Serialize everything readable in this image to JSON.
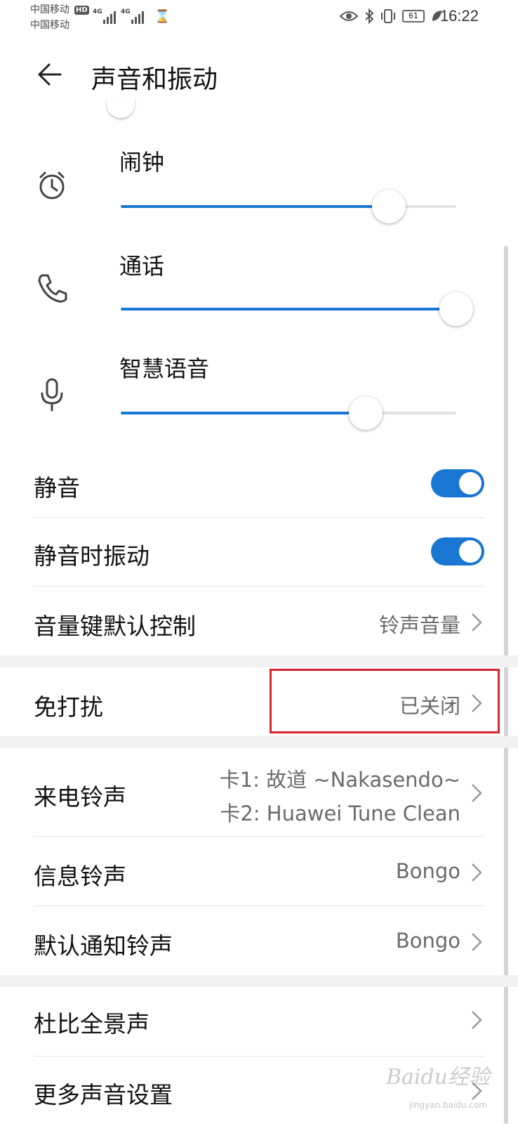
{
  "status_bar": {
    "carrier1": "中国移动",
    "carrier2": "中国移动",
    "hd": "HD",
    "sig1_label": "4G",
    "sig2_label": "4G",
    "battery": "61",
    "time": "16:22"
  },
  "header": {
    "title": "声音和振动"
  },
  "volumes": [
    {
      "label": "闹钟",
      "level_percent": 80
    },
    {
      "label": "通话",
      "level_percent": 100
    },
    {
      "label": "智慧语音",
      "level_percent": 73
    }
  ],
  "toggles": [
    {
      "label": "静音",
      "on": true
    },
    {
      "label": "静音时振动",
      "on": true
    }
  ],
  "volume_key": {
    "label": "音量键默认控制",
    "value": "铃声音量"
  },
  "dnd": {
    "label": "免打扰",
    "value": "已关闭"
  },
  "ringtone": {
    "label": "来电铃声",
    "line1": "卡1: 故道 ~Nakasendo~",
    "line2": "卡2: Huawei Tune Clean"
  },
  "message_tone": {
    "label": "信息铃声",
    "value": "Bongo"
  },
  "notification_tone": {
    "label": "默认通知铃声",
    "value": "Bongo"
  },
  "dolby": {
    "label": "杜比全景声"
  },
  "more_sound": {
    "label": "更多声音设置"
  },
  "watermark": {
    "text": "Baidu经验",
    "sub": "jingyan.baidu.com"
  },
  "colors": {
    "accent": "#1976d2",
    "highlight": "#d9242f"
  }
}
